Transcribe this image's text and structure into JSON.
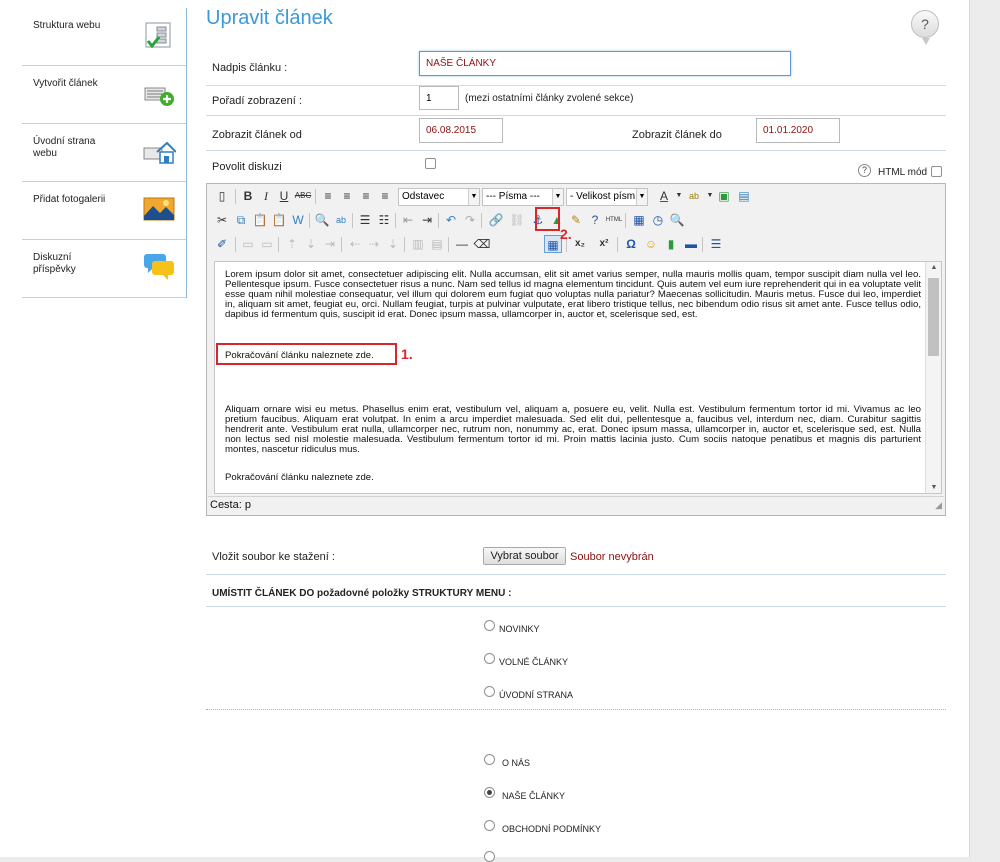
{
  "sidebar": {
    "items": [
      {
        "label": "Struktura webu",
        "icon": "site-structure-icon"
      },
      {
        "label": "Vytvořit článek",
        "icon": "create-article-icon"
      },
      {
        "label": "Úvodní strana webu",
        "icon": "homepage-icon"
      },
      {
        "label": "Přidat fotogalerii",
        "icon": "photo-gallery-icon"
      },
      {
        "label": "Diskuzní příspěvky",
        "icon": "discussion-icon"
      }
    ]
  },
  "page": {
    "title": "Upravit článek",
    "help": "?"
  },
  "form": {
    "headline_label": "Nadpis článku :",
    "headline_value": "NAŠE ČLÁNKY",
    "order_label": "Pořadí zobrazení :",
    "order_value": "1",
    "order_note": "(mezi ostatními články zvolené sekce)",
    "date_from_label": "Zobrazit článek od",
    "date_from_value": "06.08.2015",
    "date_to_label": "Zobrazit článek do",
    "date_to_value": "01.01.2020",
    "discussion_label": "Povolit diskuzi",
    "html_mode_label": "HTML mód",
    "html_mode_help": "?"
  },
  "editor": {
    "format_select": "Odstavec",
    "font_select": "--- Písma ---",
    "size_select": "- Velikost písm",
    "paragraph_1": "Lorem ipsum dolor sit amet, consectetuer adipiscing elit. Nulla accumsan, elit sit amet varius semper, nulla mauris mollis quam, tempor suscipit diam nulla vel leo. Pellentesque ipsum. Fusce consectetuer risus a nunc. Nam sed tellus id magna elementum tincidunt. Quis autem vel eum iure reprehenderit qui in ea voluptate velit esse quam nihil molestiae consequatur, vel illum qui dolorem eum fugiat quo voluptas nulla pariatur? Maecenas sollicitudin. Mauris metus. Fusce dui leo, imperdiet in, aliquam sit amet, feugiat eu, orci. Nullam feugiat, turpis at pulvinar vulputate, erat libero tristique tellus, nec bibendum odio risus sit amet ante. Fusce tellus odio, dapibus id fermentum quis, suscipit id erat. Donec ipsum massa, ullamcorper in, auctor et, scelerisque sed, est.",
    "continue_1": "Pokračování článku naleznete zde.",
    "paragraph_2": "Aliquam ornare wisi eu metus. Phasellus enim erat, vestibulum vel, aliquam a, posuere eu, velit. Nulla est. Vestibulum fermentum tortor id mi. Vivamus ac leo pretium faucibus. Aliquam erat volutpat. In enim a arcu imperdiet malesuada. Sed elit dui, pellentesque a, faucibus vel, interdum nec, diam. Curabitur sagittis hendrerit ante. Vestibulum erat nulla, ullamcorper nec, rutrum non, nonummy ac, erat. Donec ipsum massa, ullamcorper in, auctor et, scelerisque sed, est. Nulla non lectus sed nisl molestie malesuada. Vestibulum fermentum tortor id mi. Proin mattis lacinia justo. Cum sociis natoque penatibus et magnis dis parturient montes, nascetur ridiculus mus.",
    "continue_2": "Pokračování článku naleznete zde.",
    "status_path": "Cesta: p"
  },
  "annotations": {
    "one": "1.",
    "two": "2."
  },
  "upload": {
    "label": "Vložit soubor ke stažení :",
    "button": "Vybrat soubor",
    "status": "Soubor nevybrán"
  },
  "menu_section": {
    "heading": "UMÍSTIT ČLÁNEK DO požadovné položky STRUKTURY MENU :",
    "group_1": [
      {
        "label": "NOVINKY",
        "checked": false
      },
      {
        "label": "VOLNÉ ČLÁNKY",
        "checked": false
      },
      {
        "label": "ÚVODNÍ STRANA",
        "checked": false
      }
    ],
    "group_2": [
      {
        "label": "O NÁS",
        "checked": false
      },
      {
        "label": "NAŠE ČLÁNKY",
        "checked": true
      },
      {
        "label": "OBCHODNÍ PODMÍNKY",
        "checked": false
      }
    ]
  },
  "colors": {
    "accent": "#3a9ad9",
    "highlight": "#d8262b",
    "date_text": "#8a1111"
  }
}
